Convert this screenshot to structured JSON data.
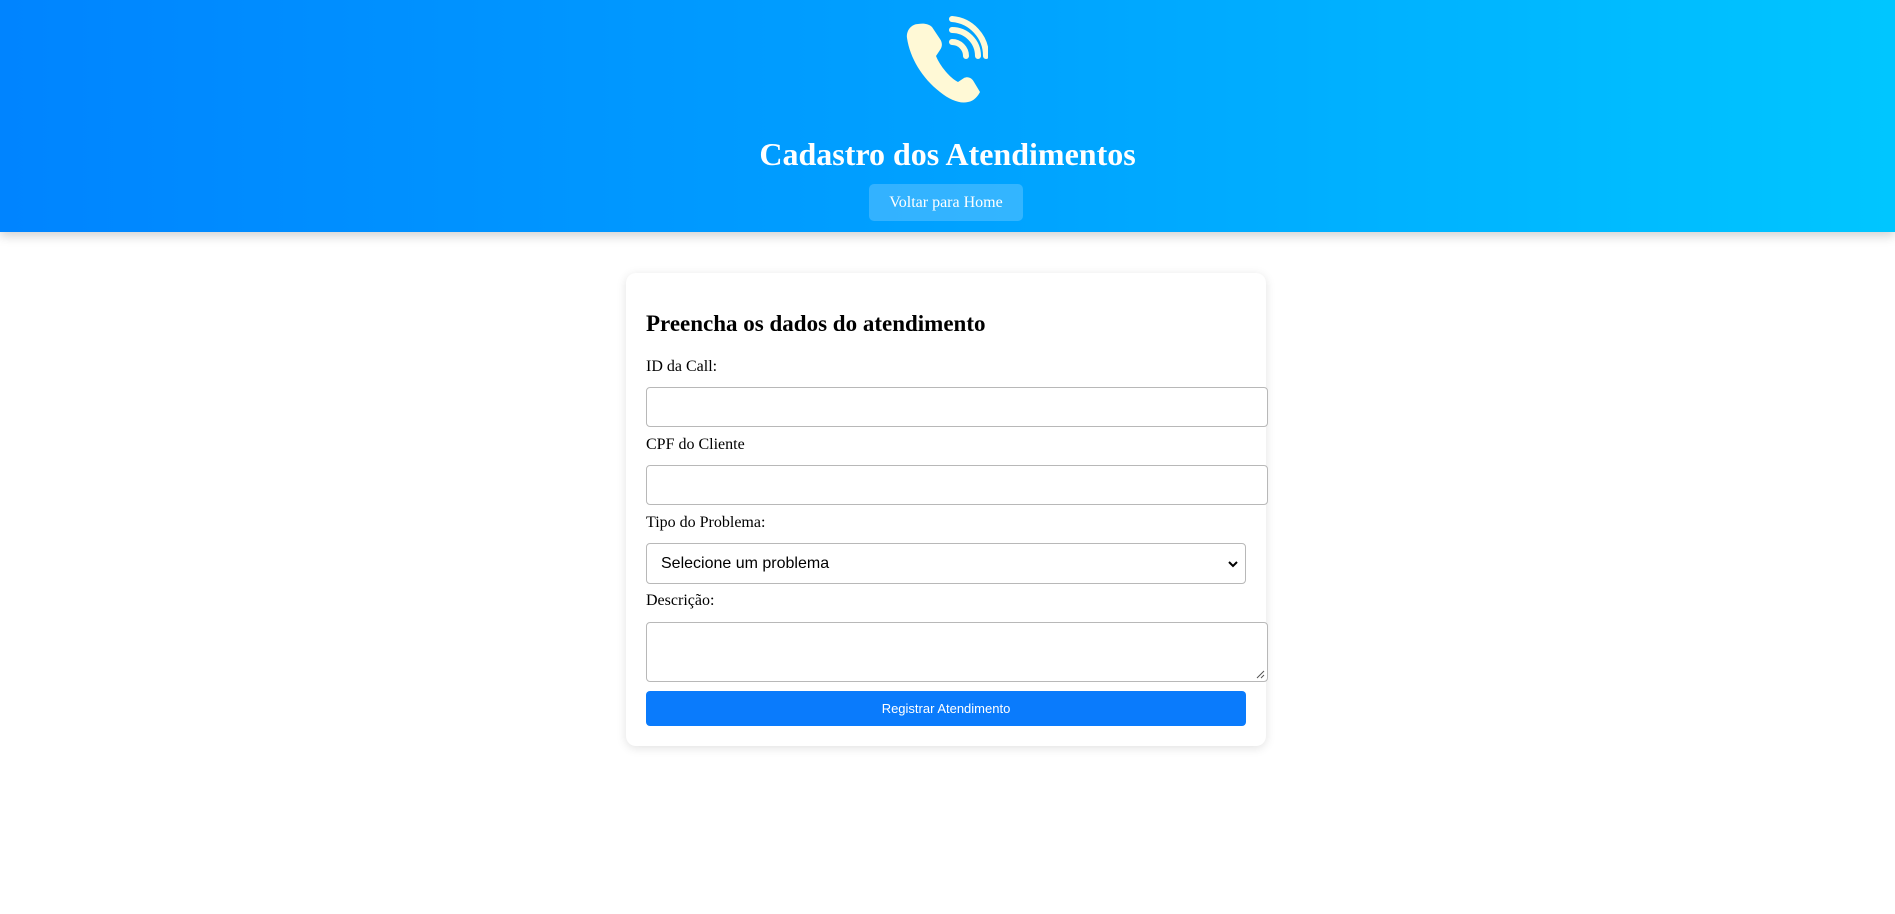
{
  "header": {
    "logo_icon": "phone-call-icon",
    "title": "Cadastro dos Atendimentos",
    "home_button_label": "Voltar para Home",
    "gradient_start": "#0084ff",
    "gradient_end": "#00c6ff",
    "logo_color": "#fff9d6"
  },
  "form": {
    "title": "Preencha os dados do atendimento",
    "fields": [
      {
        "label": "ID da Call:",
        "value": ""
      },
      {
        "label": "CPF do Cliente",
        "value": ""
      },
      {
        "label": "Tipo do Problema:",
        "selected": "Selecione um problema"
      },
      {
        "label": "Descrição:",
        "value": ""
      }
    ],
    "submit_label": "Registrar Atendimento",
    "accent_color": "#0a7bfc"
  }
}
